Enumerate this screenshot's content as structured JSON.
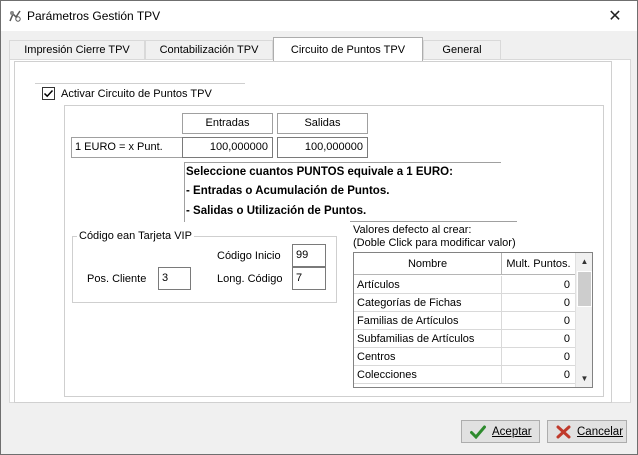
{
  "window": {
    "title": "Parámetros Gestión TPV"
  },
  "tabs": [
    {
      "label": "Impresión Cierre TPV",
      "active": false
    },
    {
      "label": "Contabilización TPV",
      "active": false
    },
    {
      "label": "Circuito de Puntos TPV",
      "active": true
    },
    {
      "label": "General",
      "active": false
    }
  ],
  "circuit": {
    "activate_label": "Activar Circuito de Puntos TPV",
    "activate_checked": true,
    "rate_label": "1 EURO = x Punt.",
    "entradas_header": "Entradas",
    "salidas_header": "Salidas",
    "entradas_value": "100,000000",
    "salidas_value": "100,000000",
    "help_lines": [
      "Seleccione cuantos PUNTOS equivale a 1 EURO:",
      "- Entradas o Acumulación de Puntos.",
      "- Salidas o Utilización de Puntos."
    ]
  },
  "vip": {
    "group_title": "Código ean Tarjeta VIP",
    "codigo_inicio_label": "Código Inicio",
    "codigo_inicio_value": "99",
    "pos_cliente_label": "Pos. Cliente",
    "pos_cliente_value": "3",
    "long_codigo_label": "Long. Código",
    "long_codigo_value": "7"
  },
  "defaults": {
    "caption_line1": "Valores defecto al crear:",
    "caption_line2": "(Doble Click para modificar valor)",
    "columns": [
      "Nombre",
      "Mult. Puntos."
    ],
    "rows": [
      {
        "name": "Artículos",
        "value": "0"
      },
      {
        "name": "Categorías de Fichas",
        "value": "0"
      },
      {
        "name": "Familias de Artículos",
        "value": "0"
      },
      {
        "name": "Subfamilias de Artículos",
        "value": "0"
      },
      {
        "name": "Centros",
        "value": "0"
      },
      {
        "name": "Colecciones",
        "value": "0"
      }
    ]
  },
  "buttons": {
    "accept": "Aceptar",
    "cancel": "Cancelar"
  }
}
